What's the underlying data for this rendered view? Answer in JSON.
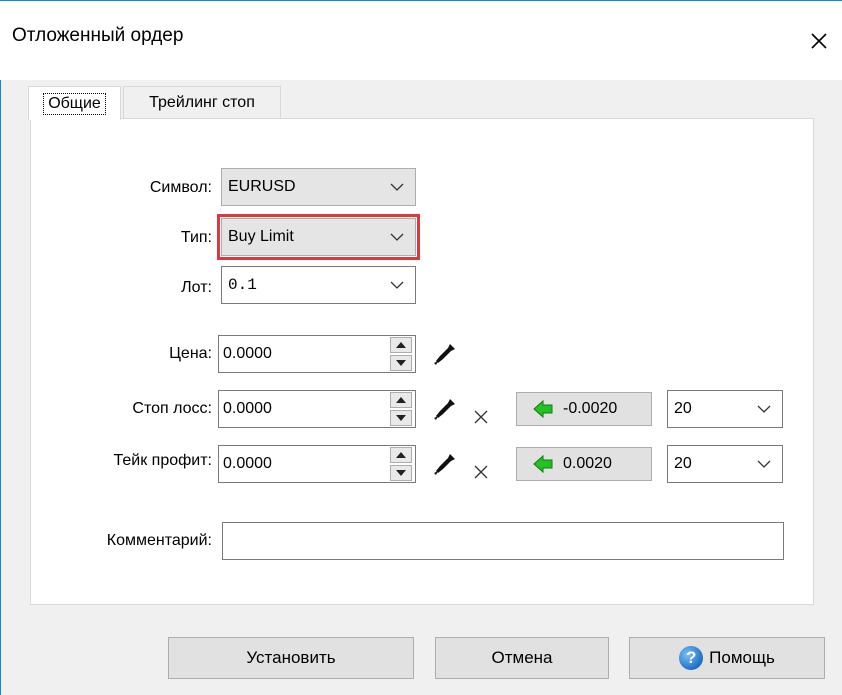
{
  "window": {
    "title": "Отложенный ордер",
    "close_glyph": "✕"
  },
  "tabs": [
    {
      "label": "Общие",
      "active": true
    },
    {
      "label": "Трейлинг стоп",
      "active": false
    }
  ],
  "form": {
    "symbol": {
      "label": "Символ:",
      "value": "EURUSD"
    },
    "type": {
      "label": "Тип:",
      "value": "Buy Limit"
    },
    "lot": {
      "label": "Лот:",
      "value": "0.1"
    },
    "price": {
      "label": "Цена:",
      "value": "0.0000"
    },
    "stop_loss": {
      "label": "Стоп лосс:",
      "value": "0.0000",
      "step_value": "-0.0020",
      "points": "20"
    },
    "take_profit": {
      "label": "Тейк профит:",
      "value": "0.0000",
      "step_value": "0.0020",
      "points": "20"
    },
    "comment": {
      "label": "Комментарий:",
      "value": ""
    }
  },
  "buttons": {
    "set": "Установить",
    "cancel": "Отмена",
    "help": "Помощь",
    "help_glyph": "?"
  },
  "icons": {
    "dropdown": "chevron-down-icon",
    "spin_up": "triangle-up-icon",
    "spin_down": "triangle-down-icon",
    "picker": "eyedropper-icon",
    "clear": "x-icon",
    "arrow": "green-left-arrow-icon",
    "help": "help-circle-icon"
  },
  "colors": {
    "accent_border": "#1883d7",
    "highlight": "#e0373c",
    "arrow_green": "#22c322"
  }
}
